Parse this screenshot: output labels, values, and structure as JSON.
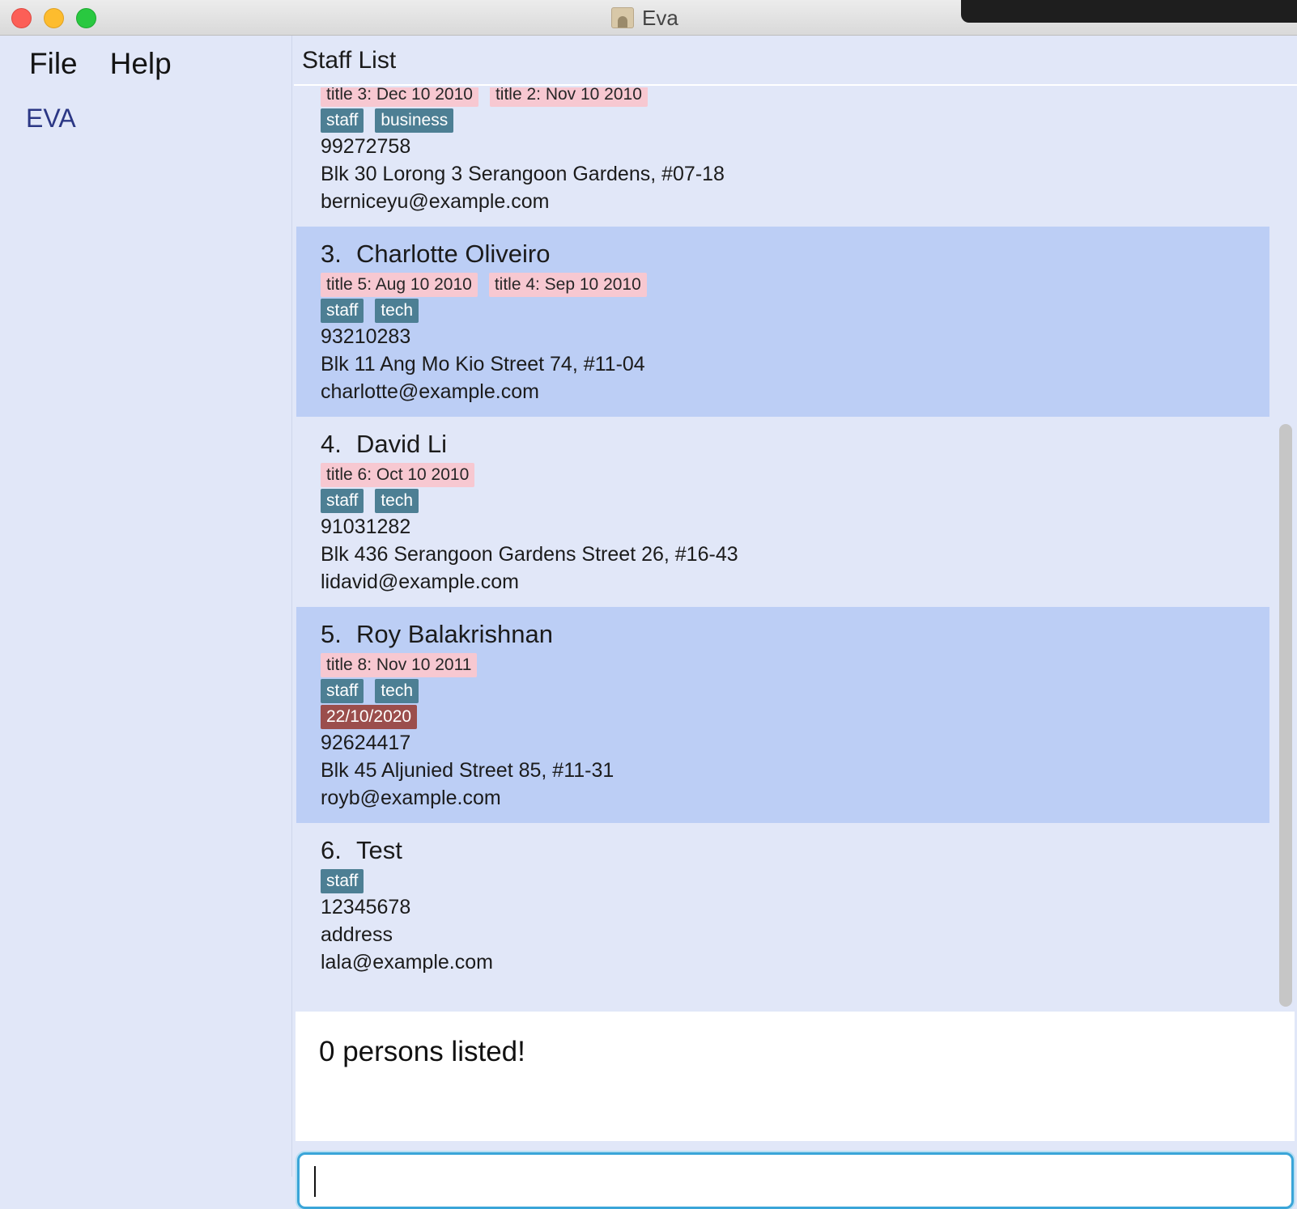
{
  "window": {
    "title": "Eva"
  },
  "menu": {
    "file": "File",
    "help": "Help"
  },
  "sidebar": {
    "brand": "EVA"
  },
  "header": {
    "title": "Staff List"
  },
  "persons": [
    {
      "index": "",
      "name": "",
      "titles": [
        "title 3: Dec 10 2010",
        "title 2: Nov 10 2010"
      ],
      "tags": [
        "staff",
        "business"
      ],
      "date": "",
      "phone": "99272758",
      "address": "Blk 30 Lorong 3 Serangoon Gardens, #07-18",
      "email": "berniceyu@example.com"
    },
    {
      "index": "3.",
      "name": "Charlotte Oliveiro",
      "titles": [
        "title 5: Aug 10 2010",
        "title 4: Sep 10 2010"
      ],
      "tags": [
        "staff",
        "tech"
      ],
      "date": "",
      "phone": "93210283",
      "address": "Blk 11 Ang Mo Kio Street 74, #11-04",
      "email": "charlotte@example.com"
    },
    {
      "index": "4.",
      "name": "David Li",
      "titles": [
        "title 6: Oct 10 2010"
      ],
      "tags": [
        "staff",
        "tech"
      ],
      "date": "",
      "phone": "91031282",
      "address": "Blk 436 Serangoon Gardens Street 26, #16-43",
      "email": "lidavid@example.com"
    },
    {
      "index": "5.",
      "name": "Roy Balakrishnan",
      "titles": [
        "title 8: Nov 10 2011"
      ],
      "tags": [
        "staff",
        "tech"
      ],
      "date": "22/10/2020",
      "phone": "92624417",
      "address": "Blk 45 Aljunied Street 85, #11-31",
      "email": "royb@example.com"
    },
    {
      "index": "6.",
      "name": "Test",
      "titles": [],
      "tags": [
        "staff"
      ],
      "date": "",
      "phone": "12345678",
      "address": "address",
      "email": "lala@example.com"
    }
  ],
  "result": {
    "message": "0 persons listed!"
  },
  "command": {
    "value": "",
    "placeholder": ""
  },
  "colors": {
    "background": "#e1e7f8",
    "selected_card": "#bccef5",
    "title_tag": "#f7c8d1",
    "category_tag": "#4d7f94",
    "date_tag": "#9b4e4c",
    "command_border": "#3aa5d8"
  }
}
